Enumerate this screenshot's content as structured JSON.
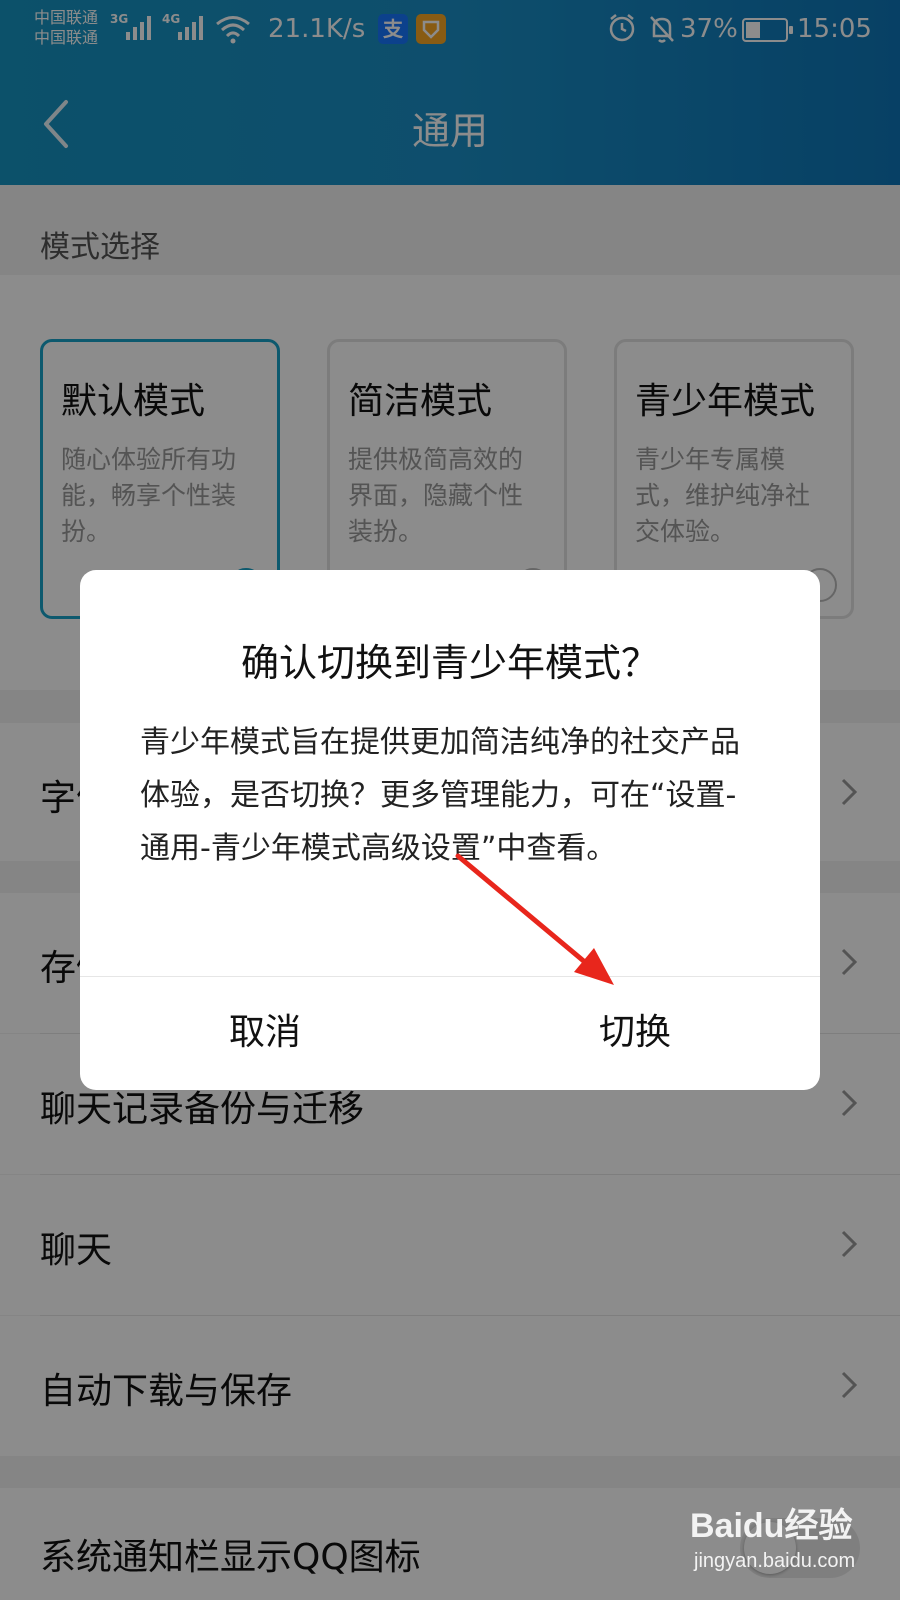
{
  "status_bar": {
    "carrier_1": "中国联通",
    "carrier_2": "中国联通",
    "signal_1_gen": "3G",
    "signal_2_gen": "4G",
    "net_speed": "21.1K/s",
    "alipay_icon_char": "支",
    "battery_pct": "37%",
    "time": "15:05",
    "battery_level": 0.37
  },
  "header": {
    "title": "通用"
  },
  "section": {
    "label": "模式选择"
  },
  "modes": [
    {
      "title": "默认模式",
      "desc": "随心体验所有功能，畅享个性装扮。",
      "selected": true
    },
    {
      "title": "简洁模式",
      "desc": "提供极简高效的界面，隐藏个性装扮。",
      "selected": false
    },
    {
      "title": "青少年模式",
      "desc": "青少年专属模式，维护纯净社交体验。",
      "selected": false
    }
  ],
  "rows": [
    {
      "label": "字体大小"
    },
    {
      "label": "存储空间"
    },
    {
      "label": "聊天记录备份与迁移"
    },
    {
      "label": "聊天"
    },
    {
      "label": "自动下载与保存"
    },
    {
      "label": "系统通知栏显示QQ图标"
    }
  ],
  "dialog": {
    "title": "确认切换到青少年模式？",
    "body": "青少年模式旨在提供更加简洁纯净的社交产品体验，是否切换？更多管理能力，可在“设置-通用-青少年模式高级设置”中查看。",
    "cancel_label": "取消",
    "confirm_label": "切换"
  },
  "watermark": {
    "logo": "Baidu经验",
    "url": "jingyan.baidu.com"
  },
  "colors": {
    "accent": "#18a2c8",
    "header_gradient_start": "#1694c2",
    "header_gradient_end": "#0e76b8",
    "arrow": "#e8261c"
  }
}
